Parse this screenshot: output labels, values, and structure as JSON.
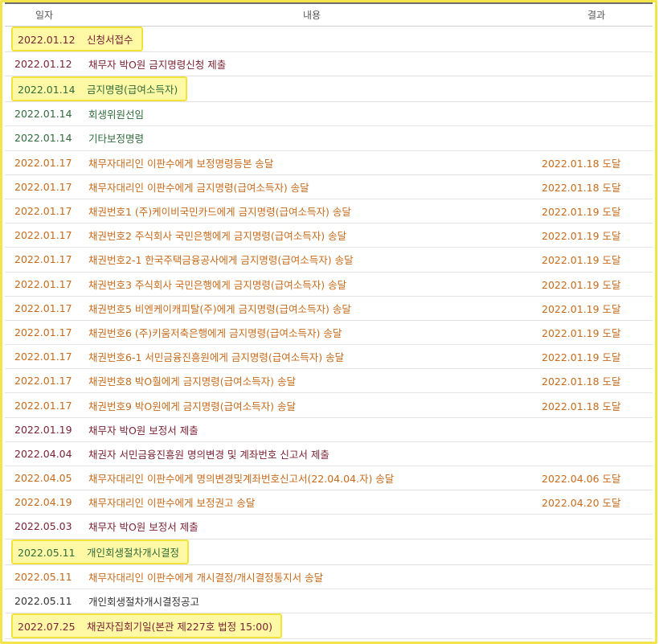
{
  "headers": {
    "date": "일자",
    "content": "내용",
    "result": "결과"
  },
  "colors": {
    "orange": "#c86b1c",
    "maroon": "#7b2234",
    "green": "#2f6b3b",
    "dark": "#333333",
    "highlight": "#fff9a6"
  },
  "rows": [
    {
      "date": "2022.01.12",
      "content": "신청서접수",
      "result": "",
      "color": "maroon",
      "highlight": true
    },
    {
      "date": "2022.01.12",
      "content": "채무자 박O원 금지명령신청 제출",
      "result": "",
      "color": "maroon",
      "highlight": false
    },
    {
      "date": "2022.01.14",
      "content": "금지명령(급여소득자)",
      "result": "",
      "color": "green",
      "highlight": true
    },
    {
      "date": "2022.01.14",
      "content": "회생위원선임",
      "result": "",
      "color": "green",
      "highlight": false
    },
    {
      "date": "2022.01.14",
      "content": "기타보정명령",
      "result": "",
      "color": "green",
      "highlight": false
    },
    {
      "date": "2022.01.17",
      "content": "채무자대리인 이판수에게 보정명령등본 송달",
      "result": "2022.01.18 도달",
      "color": "orange",
      "highlight": false
    },
    {
      "date": "2022.01.17",
      "content": "채무자대리인 이판수에게 금지명령(급여소득자) 송달",
      "result": "2022.01.18 도달",
      "color": "orange",
      "highlight": false
    },
    {
      "date": "2022.01.17",
      "content": "채권번호1 (주)케이비국민카드에게 금지명령(급여소득자) 송달",
      "result": "2022.01.19 도달",
      "color": "orange",
      "highlight": false
    },
    {
      "date": "2022.01.17",
      "content": "채권번호2 주식회사 국민은행에게 금지명령(급여소득자) 송달",
      "result": "2022.01.19 도달",
      "color": "orange",
      "highlight": false
    },
    {
      "date": "2022.01.17",
      "content": "채권번호2-1 한국주택금융공사에게 금지명령(급여소득자) 송달",
      "result": "2022.01.19 도달",
      "color": "orange",
      "highlight": false
    },
    {
      "date": "2022.01.17",
      "content": "채권번호3 주식회사 국민은행에게 금지명령(급여소득자) 송달",
      "result": "2022.01.19 도달",
      "color": "orange",
      "highlight": false
    },
    {
      "date": "2022.01.17",
      "content": "채권번호5 비엔케이캐피탈(주)에게 금지명령(급여소득자) 송달",
      "result": "2022.01.19 도달",
      "color": "orange",
      "highlight": false
    },
    {
      "date": "2022.01.17",
      "content": "채권번호6 (주)키움저축은행에게 금지명령(급여소득자) 송달",
      "result": "2022.01.19 도달",
      "color": "orange",
      "highlight": false
    },
    {
      "date": "2022.01.17",
      "content": "채권번호6-1 서민금융진흥원에게 금지명령(급여소득자) 송달",
      "result": "2022.01.19 도달",
      "color": "orange",
      "highlight": false
    },
    {
      "date": "2022.01.17",
      "content": "채권번호8 박O훨에게 금지명령(급여소득자) 송달",
      "result": "2022.01.18 도달",
      "color": "orange",
      "highlight": false
    },
    {
      "date": "2022.01.17",
      "content": "채권번호9 박O원에게 금지명령(급여소득자) 송달",
      "result": "2022.01.18 도달",
      "color": "orange",
      "highlight": false
    },
    {
      "date": "2022.01.19",
      "content": "채무자 박O원 보정서 제출",
      "result": "",
      "color": "maroon",
      "highlight": false
    },
    {
      "date": "2022.04.04",
      "content": "채권자 서민금융진흥원 명의변경 및 계좌번호 신고서 제출",
      "result": "",
      "color": "maroon",
      "highlight": false
    },
    {
      "date": "2022.04.05",
      "content": "채무자대리인 이판수에게 명의변경및계좌번호신고서(22.04.04.자) 송달",
      "result": "2022.04.06 도달",
      "color": "orange",
      "highlight": false
    },
    {
      "date": "2022.04.19",
      "content": "채무자대리인 이판수에게 보정권고 송달",
      "result": "2022.04.20 도달",
      "color": "orange",
      "highlight": false
    },
    {
      "date": "2022.05.03",
      "content": "채무자 박O원 보정서 제출",
      "result": "",
      "color": "maroon",
      "highlight": false
    },
    {
      "date": "2022.05.11",
      "content": "개인회생절차개시결정",
      "result": "",
      "color": "green",
      "highlight": true
    },
    {
      "date": "2022.05.11",
      "content": "채무자대리인 이판수에게 개시결정/개시결정통지서 송달",
      "result": "",
      "color": "orange",
      "highlight": false
    },
    {
      "date": "2022.05.11",
      "content": "개인회생절차개시결정공고",
      "result": "",
      "color": "dark",
      "highlight": false
    },
    {
      "date": "2022.07.25",
      "content": "채권자집회기일(본관 제227호 법정 15:00)",
      "result": "",
      "color": "maroon",
      "highlight": true
    }
  ]
}
